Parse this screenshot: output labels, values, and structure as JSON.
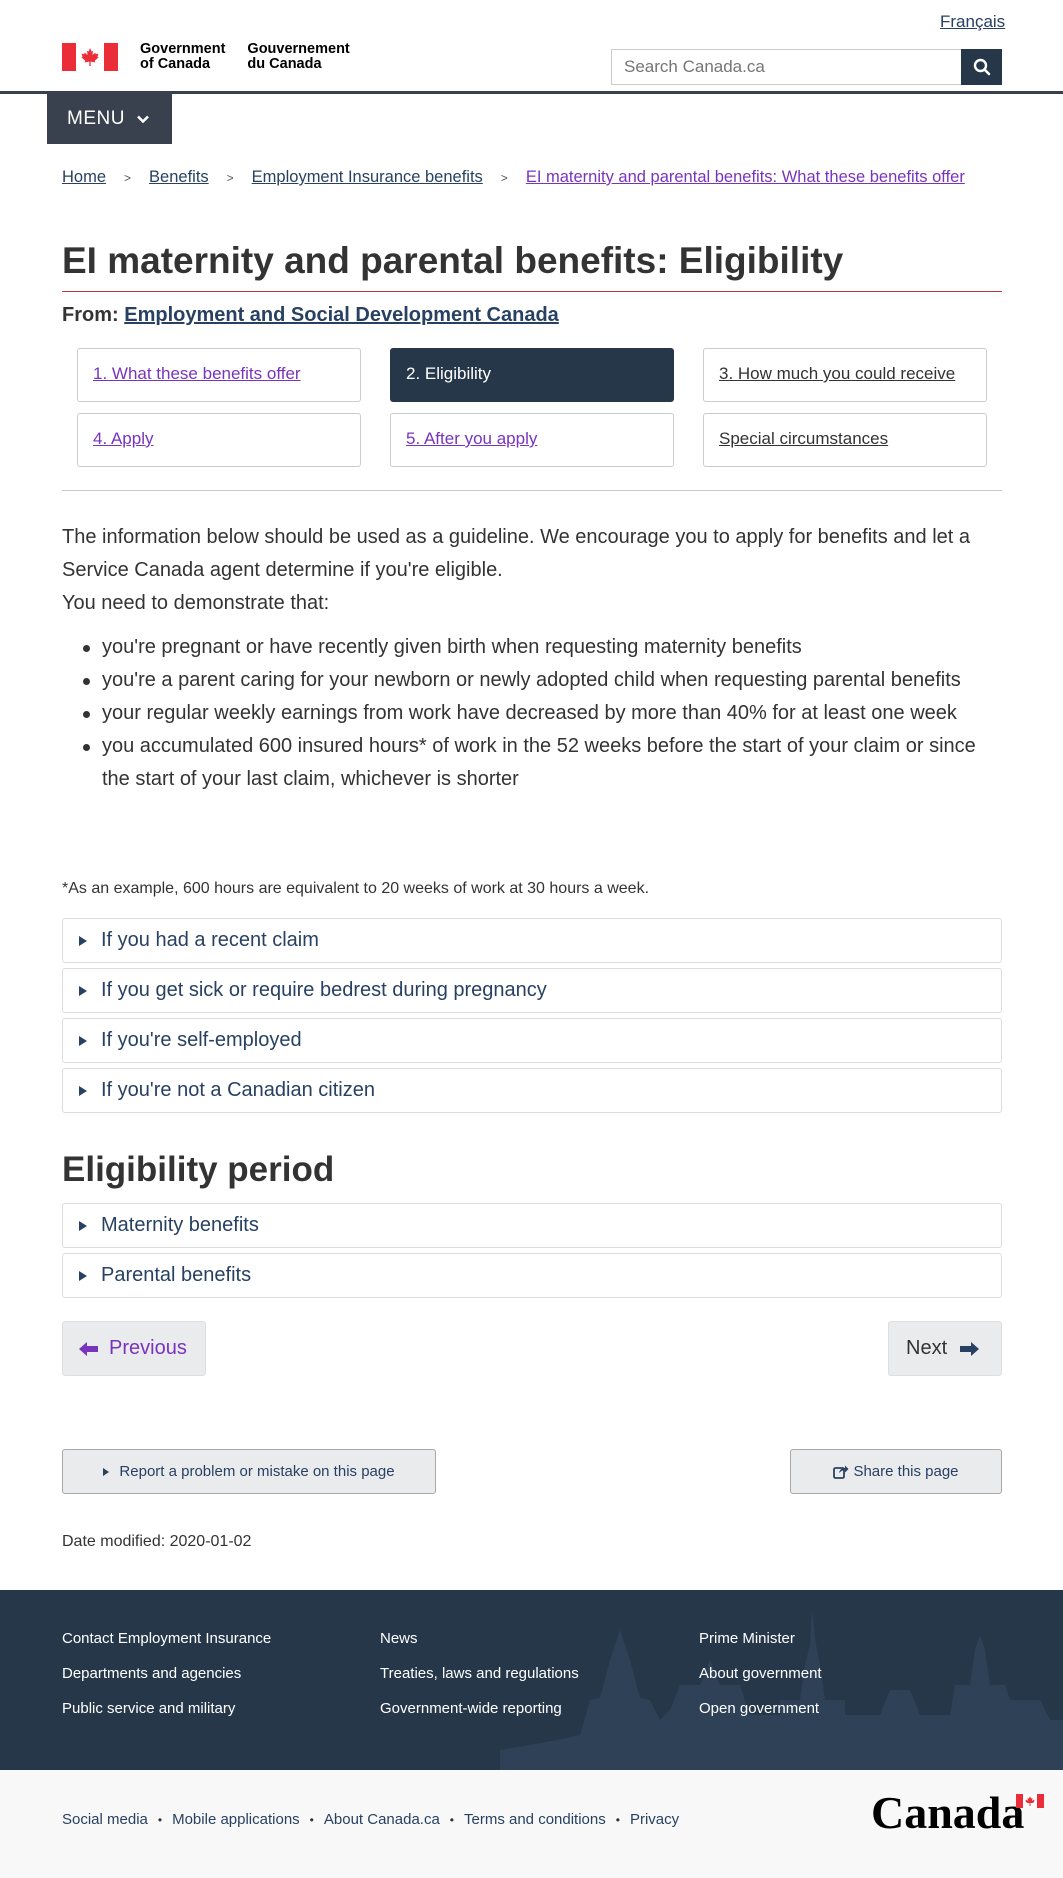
{
  "header": {
    "language_toggle": "Français",
    "signature_en": [
      "Government",
      "of Canada"
    ],
    "signature_fr": [
      "Gouvernement",
      "du Canada"
    ],
    "search_placeholder": "Search Canada.ca",
    "menu_label": "MENU"
  },
  "breadcrumb": [
    {
      "label": "Home"
    },
    {
      "label": "Benefits"
    },
    {
      "label": "Employment Insurance benefits"
    },
    {
      "label": "EI maternity and parental benefits: What these benefits offer"
    }
  ],
  "page": {
    "title": "EI maternity and parental benefits: Eligibility",
    "from_label": "From:",
    "from_link": "Employment and Social Development Canada"
  },
  "steps": [
    {
      "label": "1. What these benefits offer",
      "state": "visited"
    },
    {
      "label": "2. Eligibility",
      "state": "current"
    },
    {
      "label": "3. How much you could receive",
      "state": "default"
    },
    {
      "label": "4. Apply",
      "state": "visited"
    },
    {
      "label": "5. After you apply",
      "state": "visited"
    },
    {
      "label": "Special circumstances",
      "state": "default"
    }
  ],
  "content": {
    "intro": "The information below should be used as a guideline. We encourage you to apply for benefits and let a Service Canada agent determine if you're eligible.",
    "demonstrate": "You need to demonstrate that:",
    "bullets": [
      "you're pregnant or have recently given birth when requesting maternity benefits",
      "you're a parent caring for your newborn or newly adopted child when requesting parental benefits",
      "your regular weekly earnings from work have decreased by more than 40% for at least one week",
      "you accumulated 600 insured hours* of work in the 52 weeks before the start of your claim or since the start of your last claim, whichever is shorter"
    ],
    "footnote": "*As an example, 600 hours are equivalent to 20 weeks of work at 30 hours a week.",
    "details": [
      "If you had a recent claim",
      "If you get sick or require bedrest during pregnancy",
      "If you're self-employed",
      "If you're not a Canadian citizen"
    ],
    "eligibility_heading": "Eligibility period",
    "eligibility_details": [
      "Maternity benefits",
      "Parental benefits"
    ]
  },
  "pager": {
    "previous": "Previous",
    "next": "Next"
  },
  "actions": {
    "report": "Report a problem or mistake on this page",
    "share": "Share this page"
  },
  "date_modified": "Date modified: 2020-01-02",
  "footer": {
    "col1": [
      "Contact Employment Insurance",
      "Departments and agencies",
      "Public service and military"
    ],
    "col2": [
      "News",
      "Treaties, laws and regulations",
      "Government-wide reporting"
    ],
    "col3": [
      "Prime Minister",
      "About government",
      "Open government"
    ],
    "sub_links": [
      "Social media",
      "Mobile applications",
      "About Canada.ca",
      "Terms and conditions",
      "Privacy"
    ],
    "wordmark": "Canada"
  },
  "colors": {
    "navy": "#26374a",
    "link": "#284162",
    "visited": "#7834bc",
    "flag_red": "#eb2d37",
    "title_rule": "#af3c43"
  },
  "icons": {
    "search": "search-icon",
    "menu": "chevron-down-icon",
    "flag": "maple-leaf-icon",
    "prev": "arrow-left-icon",
    "next": "arrow-right-icon",
    "report": "caret-right-icon",
    "share": "share-icon"
  }
}
